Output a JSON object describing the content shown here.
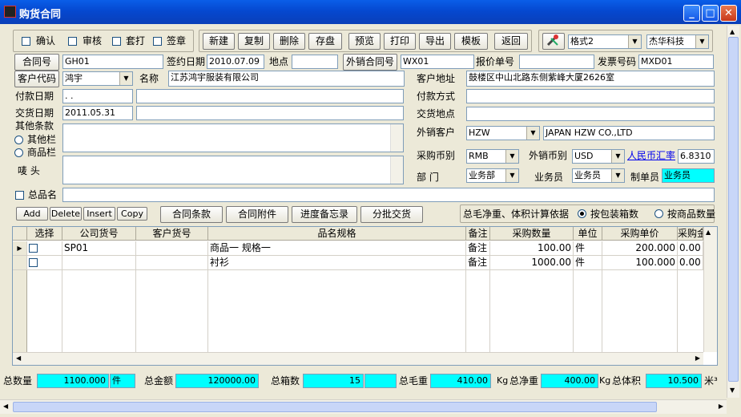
{
  "window": {
    "title": "购货合同",
    "minimize": "_",
    "maximize": "□",
    "close": "✕"
  },
  "status_checks": [
    {
      "label": "确认",
      "checked": false
    },
    {
      "label": "审核",
      "checked": false
    },
    {
      "label": "套打",
      "checked": false
    },
    {
      "label": "签章",
      "checked": false
    }
  ],
  "toolbar": {
    "buttons": [
      "新建",
      "复制",
      "删除",
      "存盘",
      "预览",
      "打印",
      "导出",
      "模板",
      "返回"
    ],
    "format_select": "格式2",
    "company_select": "杰华科技"
  },
  "form": {
    "contract_no_label": "合同号",
    "contract_no": "GH01",
    "sign_date_label": "签约日期",
    "sign_date": "2010.07.09",
    "place_label": "地点",
    "place": "",
    "export_contract_label": "外销合同号",
    "export_contract": "WX01",
    "quote_no_label": "报价单号",
    "quote_no": "",
    "invoice_no_label": "发票号码",
    "invoice_no": "MXD01",
    "customer_code_label": "客户代码",
    "customer_code": "鸿宇",
    "name_label": "名称",
    "name": "江苏鸿宇服装有限公司",
    "customer_address_label": "客户地址",
    "customer_address": "鼓楼区中山北路东侧紫峰大厦2626室",
    "pay_date_label": "付款日期",
    "pay_date": "  .  .",
    "pay_method_label": "付款方式",
    "pay_method": "",
    "delivery_date_label": "交货日期",
    "delivery_date": "2011.05.31",
    "delivery_place_label": "交货地点",
    "delivery_place": "",
    "other_terms_label": "其他条款",
    "radio_other": "其他栏",
    "radio_goods": "商品栏",
    "mark_label": "唛    头",
    "export_customer_label": "外销客户",
    "export_customer_code": "HZW",
    "export_customer_name": "JAPAN HZW CO.,LTD",
    "purchase_currency_label": "采购币别",
    "purchase_currency": "RMB",
    "export_currency_label": "外销币别",
    "export_currency": "USD",
    "rate_label": "人民币汇率",
    "rate": "6.8310",
    "dept_label": "部    门",
    "dept": "业务部",
    "salesman_label": "业务员",
    "salesman": "业务员",
    "maker_label": "制单员",
    "maker": "业务员",
    "product_name_label": "总品名",
    "product_name": ""
  },
  "row_buttons": [
    "Add",
    "Delete",
    "Insert",
    "Copy"
  ],
  "tab_buttons": [
    "合同条款",
    "合同附件",
    "进度备忘录",
    "分批交货"
  ],
  "calc": {
    "label": "总毛净重、体积计算依据",
    "option_box": "按包装箱数",
    "option_goods": "按商品数量"
  },
  "table": {
    "columns": [
      "选择",
      "公司货号",
      "客户货号",
      "品名规格",
      "备注",
      "采购数量",
      "单位",
      "采购单价",
      "采购金"
    ],
    "rows": [
      {
        "company_no": "SP01",
        "customer_no": "",
        "spec": "商品一 规格一",
        "note": "备注",
        "qty": "100.00",
        "unit": "件",
        "price": "200.000",
        "amount": "0.00"
      },
      {
        "company_no": "",
        "customer_no": "",
        "spec": "衬衫",
        "note": "备注",
        "qty": "1000.00",
        "unit": "件",
        "price": "100.000",
        "amount": "0.00"
      }
    ]
  },
  "totals": {
    "qty_label": "总数量",
    "qty": "1100.000",
    "qty_unit": "件",
    "amount_label": "总金额",
    "amount": "120000.00",
    "boxes_label": "总箱数",
    "boxes": "15",
    "gross_label": "总毛重",
    "gross": "410.00",
    "gross_unit": "Kg",
    "net_label": "总净重",
    "net": "400.00",
    "net_unit": "Kg",
    "volume_label": "总体积",
    "volume": "10.500",
    "volume_unit": "米³"
  }
}
